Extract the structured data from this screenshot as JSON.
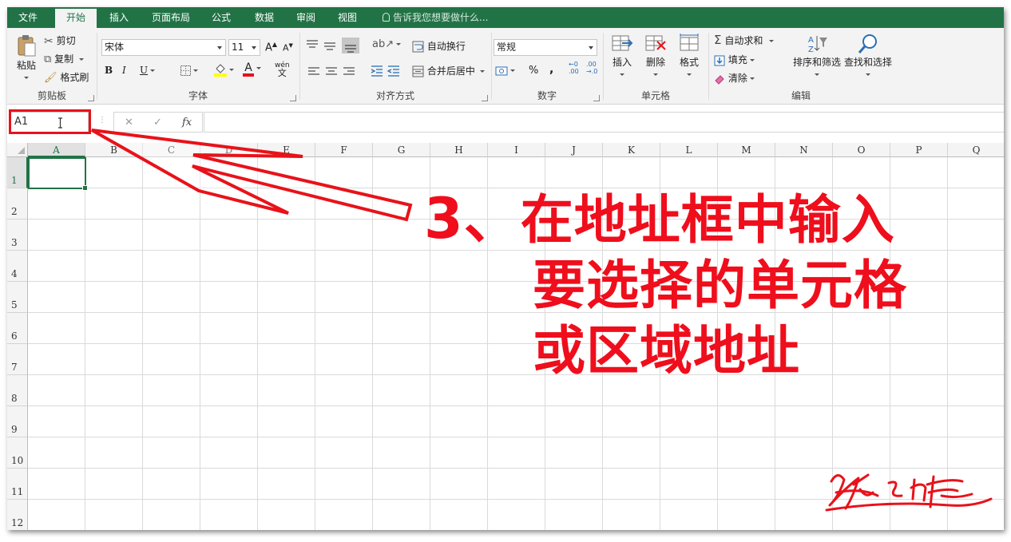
{
  "ribbon_tabs": [
    "文件",
    "开始",
    "插入",
    "页面布局",
    "公式",
    "数据",
    "审阅",
    "视图"
  ],
  "active_tab": "开始",
  "tell_me": "告诉我您想要做什么...",
  "clipboard": {
    "paste": "粘贴",
    "cut": "剪切",
    "copy": "复制",
    "format_painter": "格式刷",
    "group_label": "剪贴板"
  },
  "font": {
    "font_name": "宋体",
    "font_size": "11",
    "bold": "B",
    "italic": "I",
    "underline": "U",
    "grow": "A",
    "shrink": "A",
    "font_color_glyph": "A",
    "phonetic_top": "wén",
    "phonetic_bottom": "文",
    "group_label": "字体"
  },
  "alignment": {
    "wrap_text": "自动换行",
    "merge_center": "合并后居中",
    "group_label": "对齐方式"
  },
  "number": {
    "format": "常规",
    "percent": "%",
    "comma": ",",
    "inc_decimal_top": "←0",
    "inc_decimal_bottom": ".00",
    "dec_decimal_top": ".00",
    "dec_decimal_bottom": "→.0",
    "group_label": "数字"
  },
  "cells": {
    "insert": "插入",
    "delete": "删除",
    "format": "格式",
    "group_label": "单元格"
  },
  "editing": {
    "autosum": "自动求和",
    "fill": "填充",
    "clear": "清除",
    "sort_filter": "排序和筛选",
    "find_select": "查找和选择",
    "group_label": "编辑"
  },
  "formula_bar": {
    "name_box": "A1",
    "cancel": "✕",
    "enter": "✓",
    "fx": "fx",
    "formula": ""
  },
  "columns": [
    "A",
    "B",
    "C",
    "D",
    "E",
    "F",
    "G",
    "H",
    "I",
    "J",
    "K",
    "L",
    "M",
    "N",
    "O",
    "P",
    "Q"
  ],
  "rows": [
    "1",
    "2",
    "3",
    "4",
    "5",
    "6",
    "7",
    "8",
    "9",
    "10",
    "11",
    "12"
  ],
  "active_cell": "A1",
  "annotation": {
    "step": "3、",
    "line1": "在地址框中输入",
    "line2": "要选择的单元格",
    "line3": "或区域地址",
    "color": "#ef0e1c"
  },
  "colors": {
    "excel_green": "#217346",
    "highlight_red": "#e8121a"
  }
}
